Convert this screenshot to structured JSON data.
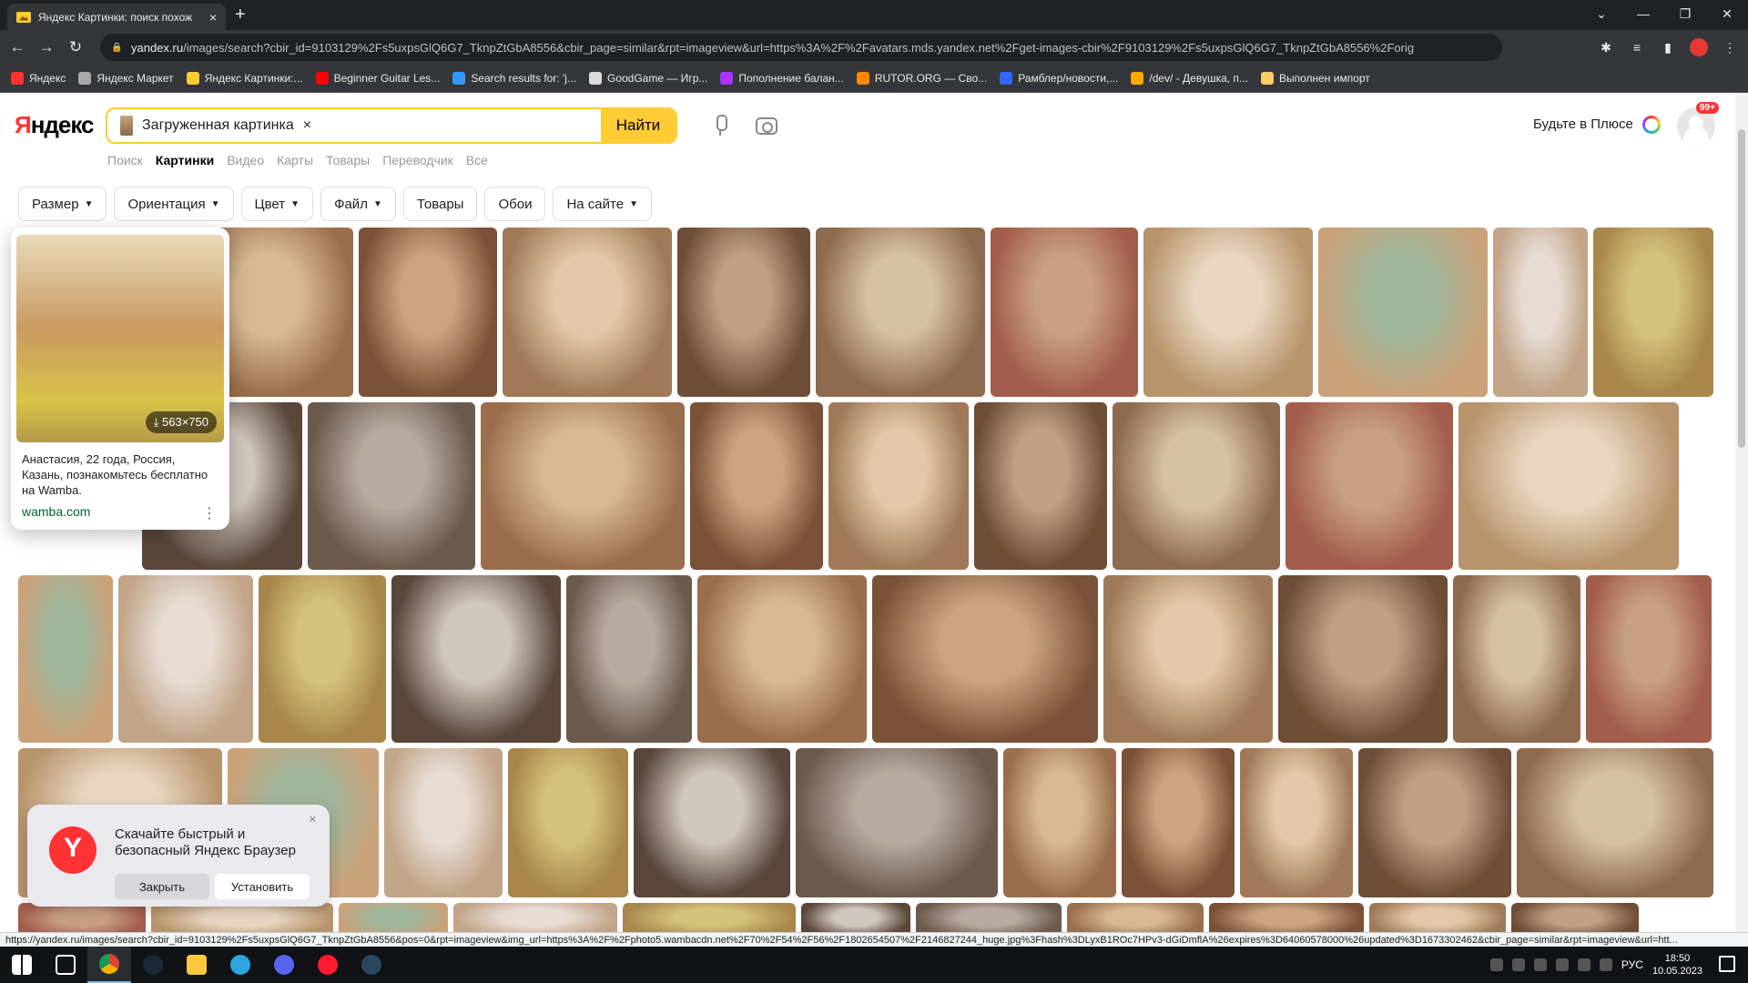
{
  "browser": {
    "tab_title": "Яндекс Картинки: поиск похож",
    "tab_close": "×",
    "new_tab": "+",
    "url_host": "yandex.ru",
    "url_path": "/images/search?cbir_id=9103129%2Fs5uxpsGlQ6G7_TknpZtGbA8556&cbir_page=similar&rpt=imageview&url=https%3A%2F%2Favatars.mds.yandex.net%2Fget-images-cbir%2F9103129%2Fs5uxpsGlQ6G7_TknpZtGbA8556%2Forig",
    "bookmarks": [
      {
        "label": "Яндекс",
        "color": "#f33"
      },
      {
        "label": "Яндекс Маркет",
        "color": "#aaa"
      },
      {
        "label": "Яндекс Картинки:...",
        "color": "#fc3"
      },
      {
        "label": "Beginner Guitar Les...",
        "color": "#f00"
      },
      {
        "label": "Search results for: 'j...",
        "color": "#39f"
      },
      {
        "label": "GoodGame — Игр...",
        "color": "#ddd"
      },
      {
        "label": "Пополнение балан...",
        "color": "#a3f"
      },
      {
        "label": "RUTOR.ORG — Сво...",
        "color": "#f80"
      },
      {
        "label": "Рамблер/новости,...",
        "color": "#36f"
      },
      {
        "label": "/dev/ - Девушка, п...",
        "color": "#fa0"
      },
      {
        "label": "Выполнен импорт",
        "color": "#fc6"
      }
    ]
  },
  "header": {
    "logo": "Яндекс",
    "search_chip": "Загруженная картинка",
    "clear": "×",
    "search_button": "Найти",
    "plus_text": "Будьте в Плюсе",
    "badge": "99+"
  },
  "services": [
    "Поиск",
    "Картинки",
    "Видео",
    "Карты",
    "Товары",
    "Переводчик",
    "Все"
  ],
  "filters": [
    {
      "label": "Размер",
      "chevron": true
    },
    {
      "label": "Ориентация",
      "chevron": true
    },
    {
      "label": "Цвет",
      "chevron": true
    },
    {
      "label": "Файл",
      "chevron": true
    },
    {
      "label": "Товары",
      "chevron": false
    },
    {
      "label": "Обои",
      "chevron": false
    },
    {
      "label": "На сайте",
      "chevron": true
    }
  ],
  "hover_card": {
    "dimensions": "563×750",
    "description": "Анастасия, 22 года, Россия, Казань, познакомьтесь бесплатно на Wamba.",
    "site": "wamba.com",
    "more": "⋮"
  },
  "promo": {
    "text": "Скачайте быстрый и безопасный Яндекс Браузер",
    "close_button": "Закрыть",
    "install_button": "Установить"
  },
  "status_url": "https://yandex.ru/images/search?cbir_id=9103129%2Fs5uxpsGlQ6G7_TknpZtGbA8556&pos=0&rpt=imageview&img_url=https%3A%2F%2Fphoto5.wambacdn.net%2F70%2F54%2F56%2F1802654507%2F2146827244_huge.jpg%3Fhash%3DLyxB1ROc7HPv3-dGiDmflA%26expires%3D64060578000%26updated%3D1673302462&cbir_page=similar&rpt=imageview&url=htt...",
  "taskbar": {
    "lang": "РУС",
    "time": "18:50",
    "date": "10.05.2023"
  }
}
